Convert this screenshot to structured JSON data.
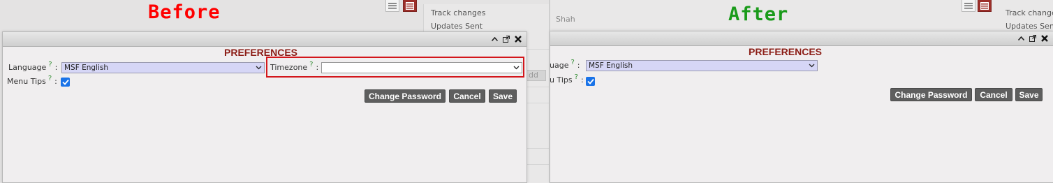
{
  "labels": {
    "before": "Before",
    "after": "After"
  },
  "colors": {
    "before": "#ff0000",
    "after": "#1a9b1a",
    "title": "#8b1c15",
    "highlight": "#d3161b",
    "button": "#5e5e5e",
    "select_bg": "#d6d6f6",
    "checkbox": "#1a73e8"
  },
  "background_panel": {
    "items": [
      "Track changes",
      "Updates Sent"
    ],
    "user_fragment": "Shah",
    "add_fragment": "dd"
  },
  "before": {
    "title": "PREFERENCES",
    "language": {
      "label": "Language",
      "help": "?",
      "colon": ":",
      "value": "MSF English"
    },
    "timezone": {
      "label": "Timezone",
      "help": "?",
      "colon": ":",
      "value": ""
    },
    "menu_tips": {
      "label": "Menu Tips",
      "help": "?",
      "colon": ":",
      "checked": true
    },
    "buttons": {
      "change_password": "Change Password",
      "cancel": "Cancel",
      "save": "Save"
    }
  },
  "after": {
    "title": "PREFERENCES",
    "language": {
      "label_fragment": "uage",
      "help": "?",
      "colon": ":",
      "value": "MSF English"
    },
    "menu_tips": {
      "label_fragment": "u Tips",
      "help": "?",
      "colon": ":",
      "checked": true
    },
    "buttons": {
      "change_password": "Change Password",
      "cancel": "Cancel",
      "save": "Save"
    }
  },
  "icons": [
    "list-view-icon",
    "table-view-icon",
    "minimize-icon",
    "popout-icon",
    "close-icon",
    "chevron-down-icon",
    "checkmark-icon"
  ]
}
